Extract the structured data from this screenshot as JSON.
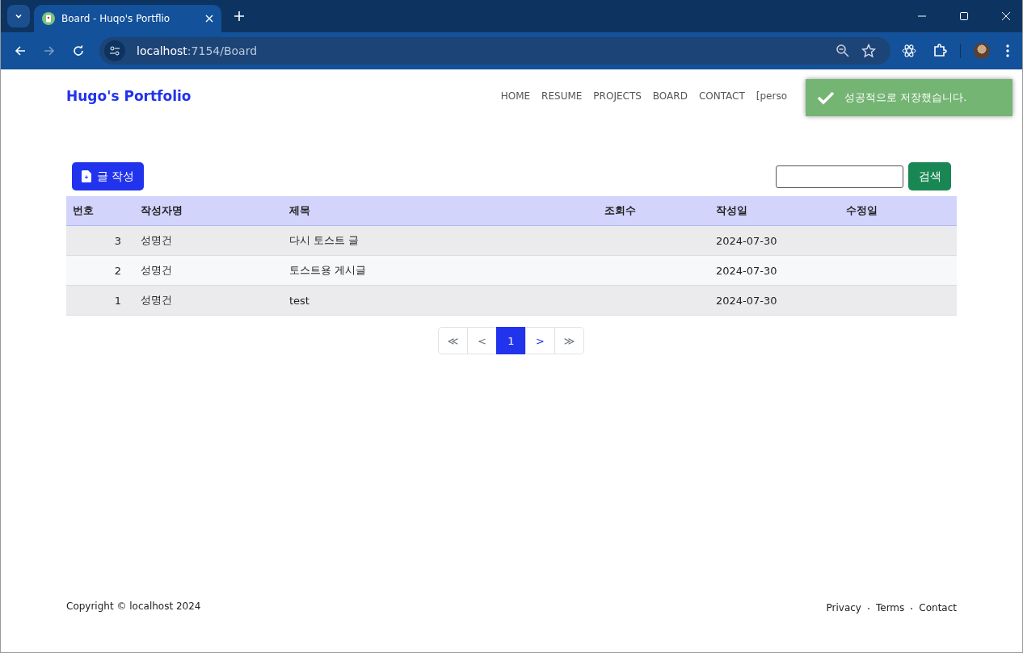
{
  "browser": {
    "tab_title": "Board - Huqo's Portflio",
    "url_host": "localhost",
    "url_path": ":7154/Board"
  },
  "brand": "Hugo's Portfolio",
  "nav": [
    "HOME",
    "RESUME",
    "PROJECTS",
    "BOARD",
    "CONTACT",
    "[perso"
  ],
  "toast": {
    "message": "성공적으로 저장했습니다."
  },
  "write_button": "글 작성",
  "search": {
    "button": "검색"
  },
  "table": {
    "columns": [
      "번호",
      "작성자명",
      "제목",
      "조회수",
      "작성일",
      "수정일"
    ],
    "rows": [
      {
        "no": "3",
        "author": "성명건",
        "title": "다시 토스트 글",
        "created": "2024-07-30"
      },
      {
        "no": "2",
        "author": "성명건",
        "title": "토스트용 게시글",
        "created": "2024-07-30"
      },
      {
        "no": "1",
        "author": "성명건",
        "title": "test",
        "created": "2024-07-30"
      }
    ]
  },
  "pagination": [
    {
      "label": "≪",
      "selected": false,
      "disabled": true
    },
    {
      "label": "<",
      "selected": false,
      "disabled": true
    },
    {
      "label": "1",
      "selected": true,
      "disabled": false
    },
    {
      "label": ">",
      "selected": false,
      "disabled": false
    },
    {
      "label": "≫",
      "selected": false,
      "disabled": true
    }
  ],
  "footer": {
    "copyright": "Copyright © localhost 2024",
    "links": [
      "Privacy",
      "Terms",
      "Contact"
    ]
  }
}
